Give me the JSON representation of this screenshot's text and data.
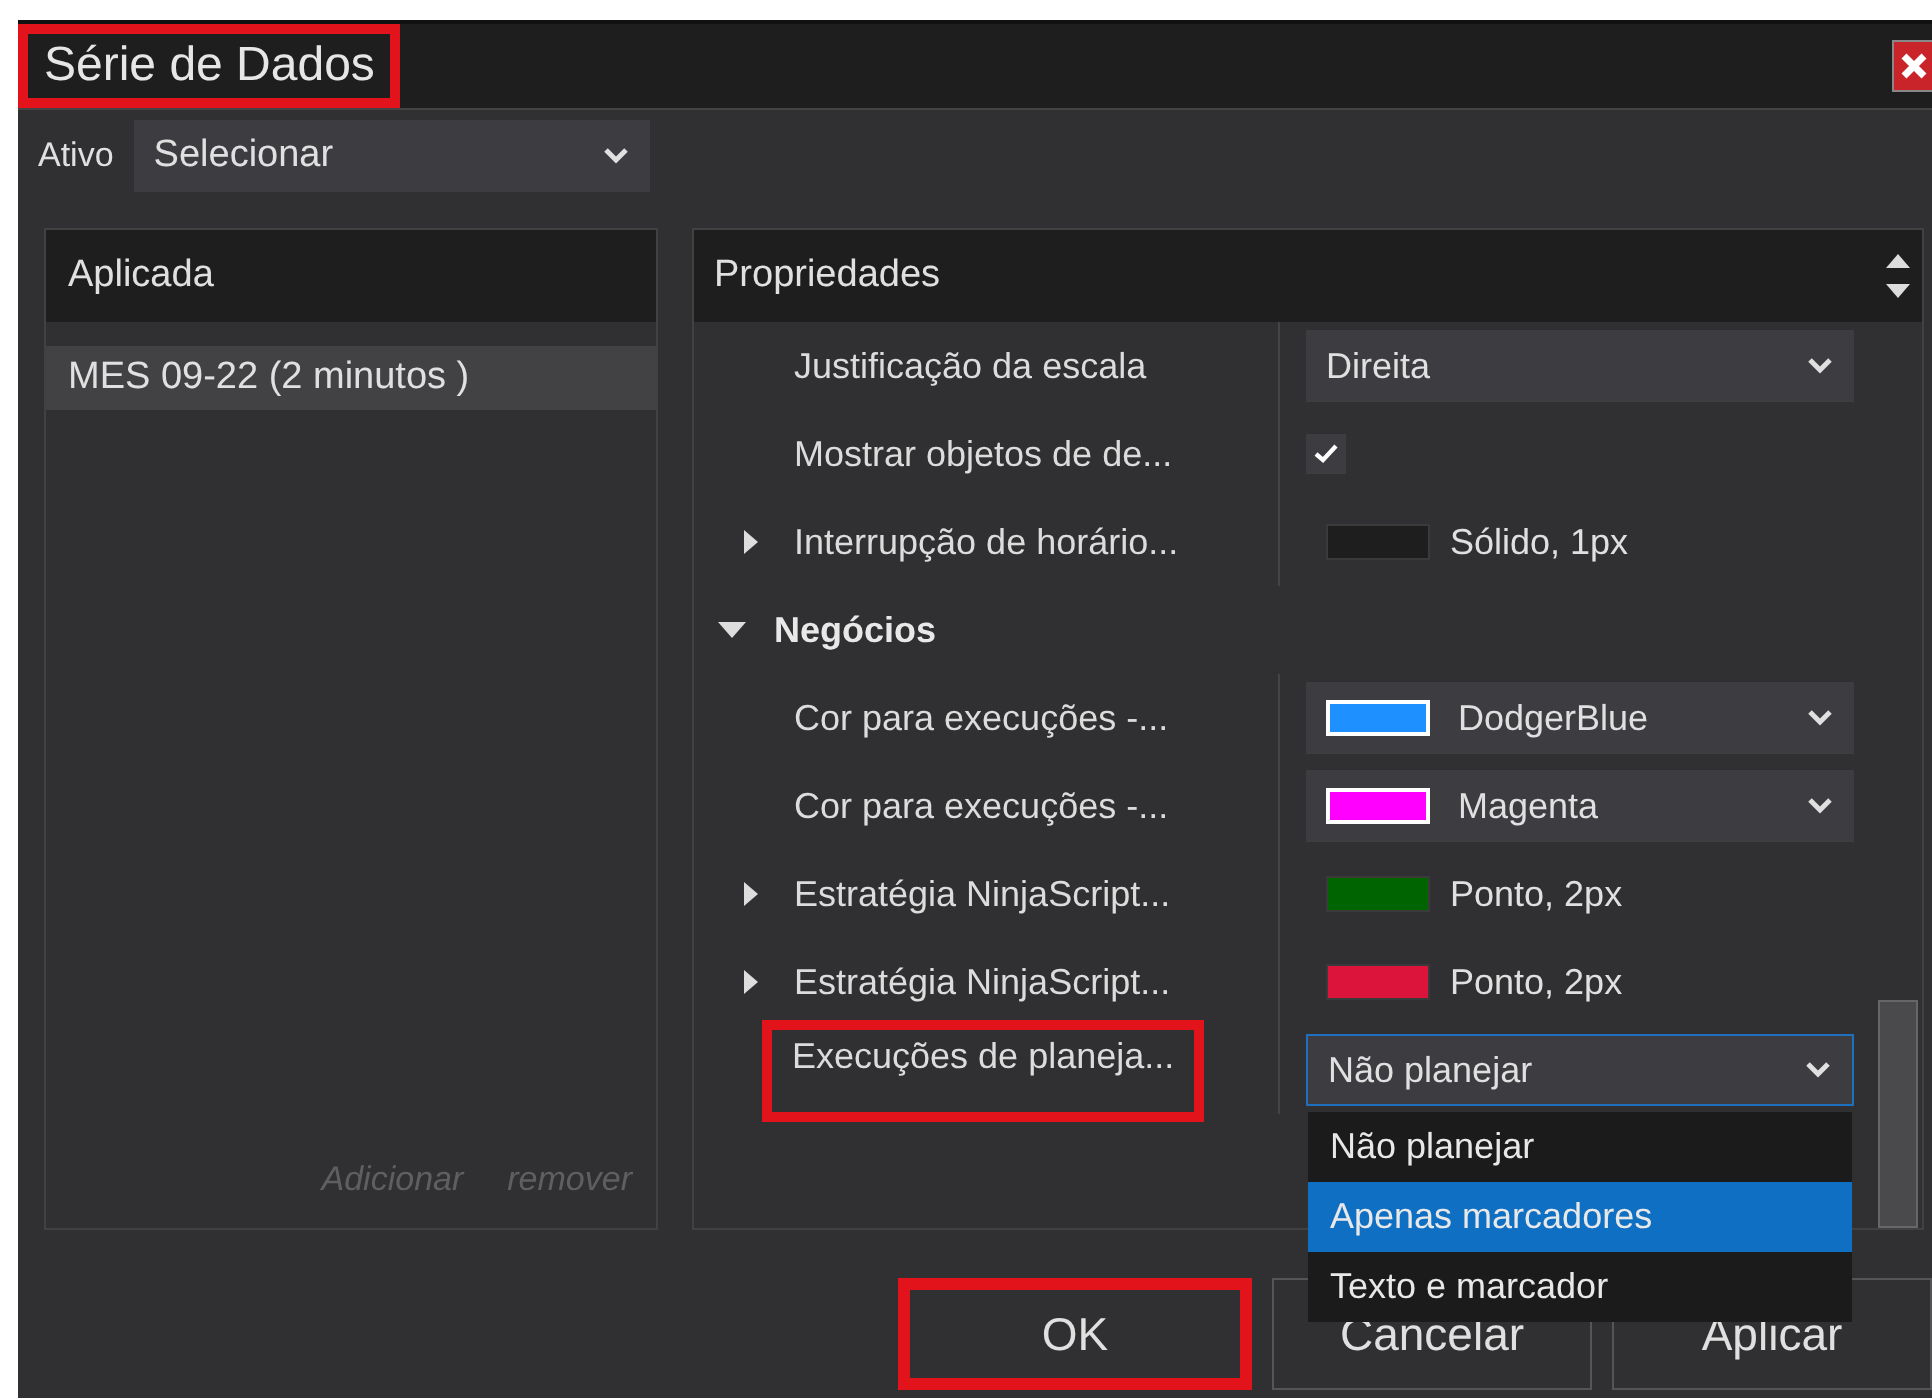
{
  "window": {
    "title": "Série de Dados",
    "title_highlighted": true
  },
  "instrument": {
    "label": "Ativo",
    "value": "Selecionar"
  },
  "applied": {
    "header": "Aplicada",
    "items": [
      {
        "label": "MES 09-22 (2 minutos )",
        "selected": true
      }
    ],
    "actions": [
      "Adicionar",
      "remover"
    ]
  },
  "properties": {
    "header": "Propriedades",
    "rows": [
      {
        "kind": "dropdown",
        "label": "Justificação da escala",
        "value": "Direita"
      },
      {
        "kind": "checkbox",
        "label": "Mostrar objetos de de...",
        "checked": true
      },
      {
        "kind": "stroke",
        "label": "Interrupção de horário...",
        "expanded": false,
        "color": "#1e1e1e",
        "value": "Sólido, 1px"
      },
      {
        "kind": "category",
        "label": "Negócios",
        "expanded": true
      },
      {
        "kind": "color",
        "label": "Cor para execuções -...",
        "color": "#1e90ff",
        "value": "DodgerBlue"
      },
      {
        "kind": "color",
        "label": "Cor para execuções -...",
        "color": "#ff00ff",
        "value": "Magenta"
      },
      {
        "kind": "stroke",
        "label": "Estratégia NinjaScript...",
        "expanded": false,
        "color": "#006400",
        "value": "Ponto, 2px"
      },
      {
        "kind": "stroke",
        "label": "Estratégia NinjaScript...",
        "expanded": false,
        "color": "#dc143c",
        "value": "Ponto, 2px"
      },
      {
        "kind": "dropdown",
        "label": "Execuções de planeja...",
        "value": "Não planejar",
        "highlighted": true,
        "open": true,
        "options": [
          {
            "label": "Não planejar",
            "highlighted": false
          },
          {
            "label": "Apenas marcadores",
            "highlighted": true
          },
          {
            "label": "Texto e marcador",
            "highlighted": false
          }
        ]
      }
    ]
  },
  "buttons": [
    {
      "label": "OK",
      "highlighted": true
    },
    {
      "label": "Cancelar",
      "highlighted": false
    },
    {
      "label": "Aplicar",
      "highlighted": false
    }
  ]
}
